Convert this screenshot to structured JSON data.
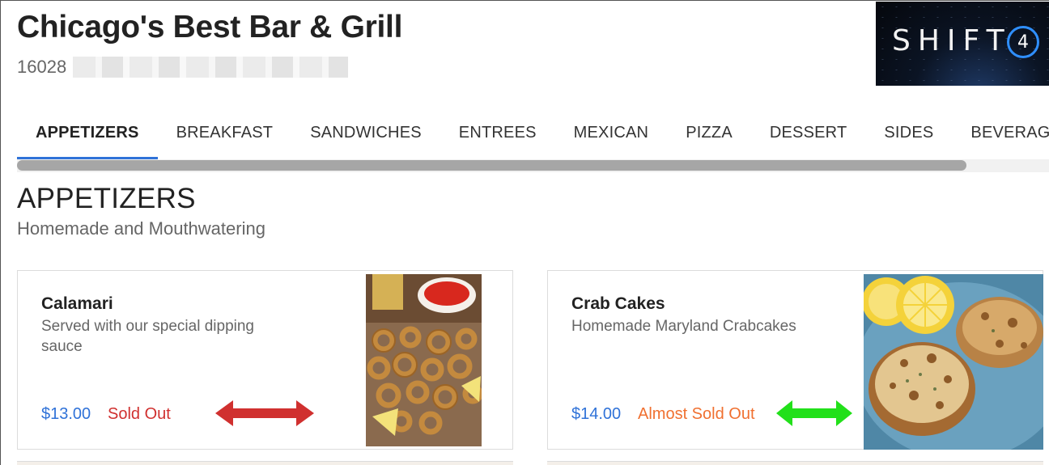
{
  "header": {
    "restaurant_name": "Chicago's Best Bar & Grill",
    "address_visible": "16028"
  },
  "logo": {
    "text": "SHIFT",
    "mark": "4"
  },
  "tabs": [
    {
      "label": "APPETIZERS",
      "active": true
    },
    {
      "label": "BREAKFAST",
      "active": false
    },
    {
      "label": "SANDWICHES",
      "active": false
    },
    {
      "label": "ENTREES",
      "active": false
    },
    {
      "label": "MEXICAN",
      "active": false
    },
    {
      "label": "PIZZA",
      "active": false
    },
    {
      "label": "DESSERT",
      "active": false
    },
    {
      "label": "SIDES",
      "active": false
    },
    {
      "label": "BEVERAGES",
      "active": false
    }
  ],
  "section": {
    "title": "APPETIZERS",
    "subtitle": "Homemade and Mouthwatering"
  },
  "items": [
    {
      "name": "Calamari",
      "description": "Served with our special dipping sauce",
      "price": "$13.00",
      "status": "Sold Out",
      "status_color": "#d0302f",
      "arrow_color": "#d0302f"
    },
    {
      "name": "Crab Cakes",
      "description": "Homemade Maryland Crabcakes",
      "price": "$14.00",
      "status": "Almost Sold Out",
      "status_color": "#f07030",
      "arrow_color": "#22e01a"
    }
  ],
  "colors": {
    "accent": "#2f72d8",
    "price": "#2f72d8"
  }
}
